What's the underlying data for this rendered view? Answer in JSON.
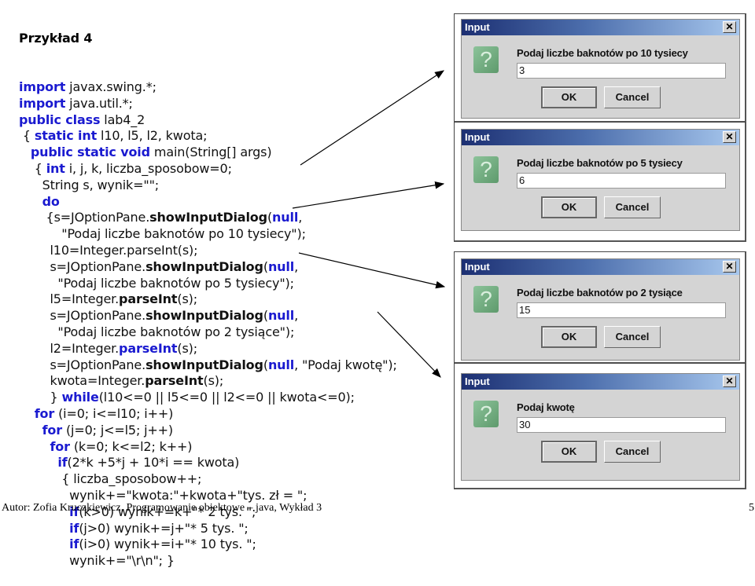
{
  "slide": {
    "title": "Przykład 4",
    "footer": "Autor: Zofia Kruczkiewicz, Programowanie obiektowe – java, Wykład 3",
    "page_number": "5"
  },
  "code_lines": [
    [
      {
        "t": "import",
        "c": "kw"
      },
      {
        "t": " javax.swing.*;"
      }
    ],
    [
      {
        "t": "import",
        "c": "kw"
      },
      {
        "t": " java.util.*;"
      }
    ],
    [
      {
        "t": "public class",
        "c": "kw"
      },
      {
        "t": " lab4_2"
      }
    ],
    [
      {
        "t": " { "
      },
      {
        "t": "static int",
        "c": "kw"
      },
      {
        "t": " l10, l5, l2, kwota;"
      }
    ],
    [
      {
        "t": "   "
      },
      {
        "t": "public static void",
        "c": "kw"
      },
      {
        "t": " main(String[] args)"
      }
    ],
    [
      {
        "t": "    { "
      },
      {
        "t": "int",
        "c": "kw"
      },
      {
        "t": " i, j, k, liczba_sposobow=0;"
      }
    ],
    [
      {
        "t": "      String s, wynik=\"\";"
      }
    ],
    [
      {
        "t": "      "
      },
      {
        "t": "do",
        "c": "kw"
      }
    ],
    [
      {
        "t": "       {s=JOptionPane."
      },
      {
        "t": "showInputDialog",
        "c": "bd"
      },
      {
        "t": "("
      },
      {
        "t": "null",
        "c": "kw"
      },
      {
        "t": ","
      }
    ],
    [
      {
        "t": "           \"Podaj liczbe baknotów po 10 tysiecy\");"
      }
    ],
    [
      {
        "t": "        l10=Integer.parseInt(s);"
      }
    ],
    [
      {
        "t": "        s=JOptionPane."
      },
      {
        "t": "showInputDialog",
        "c": "bd"
      },
      {
        "t": "("
      },
      {
        "t": "null",
        "c": "kw"
      },
      {
        "t": ","
      }
    ],
    [
      {
        "t": "          \"Podaj liczbe baknotów po 5 tysiecy\");"
      }
    ],
    [
      {
        "t": "        l5=Integer."
      },
      {
        "t": "parseInt",
        "c": "bd"
      },
      {
        "t": "(s);"
      }
    ],
    [
      {
        "t": "        s=JOptionPane."
      },
      {
        "t": "showInputDialog",
        "c": "bd"
      },
      {
        "t": "("
      },
      {
        "t": "null",
        "c": "kw"
      },
      {
        "t": ","
      }
    ],
    [
      {
        "t": "          \"Podaj liczbe baknotów po 2 tysiące\");"
      }
    ],
    [
      {
        "t": "        l2=Integer."
      },
      {
        "t": "parseInt",
        "c": "kw"
      },
      {
        "t": "(s);"
      }
    ],
    [
      {
        "t": "        s=JOptionPane."
      },
      {
        "t": "showInputDialog",
        "c": "bd"
      },
      {
        "t": "("
      },
      {
        "t": "null",
        "c": "kw"
      },
      {
        "t": ", \"Podaj kwotę\");"
      }
    ],
    [
      {
        "t": "        kwota=Integer."
      },
      {
        "t": "parseInt",
        "c": "bd"
      },
      {
        "t": "(s);"
      }
    ],
    [
      {
        "t": "        } "
      },
      {
        "t": "while",
        "c": "kw"
      },
      {
        "t": "(l10<=0 || l5<=0 || l2<=0 || kwota<=0);"
      }
    ],
    [
      {
        "t": "    "
      },
      {
        "t": "for",
        "c": "kw"
      },
      {
        "t": " (i=0; i<=l10; i++)"
      }
    ],
    [
      {
        "t": "      "
      },
      {
        "t": "for",
        "c": "kw"
      },
      {
        "t": " (j=0; j<=l5; j++)"
      }
    ],
    [
      {
        "t": "        "
      },
      {
        "t": "for",
        "c": "kw"
      },
      {
        "t": " (k=0; k<=l2; k++)"
      }
    ],
    [
      {
        "t": "          "
      },
      {
        "t": "if",
        "c": "kw"
      },
      {
        "t": "(2*k +5*j + 10*i == kwota)"
      }
    ],
    [
      {
        "t": "           { liczba_sposobow++;"
      }
    ],
    [
      {
        "t": "             wynik+=\"kwota:\"+kwota+\"tys. zł = \";"
      }
    ],
    [
      {
        "t": "             "
      },
      {
        "t": "if",
        "c": "kw"
      },
      {
        "t": "(k>0) wynik+=k+\"* 2 tys. \";"
      }
    ],
    [
      {
        "t": "             "
      },
      {
        "t": "if",
        "c": "kw"
      },
      {
        "t": "(j>0) wynik+=j+\"* 5 tys. \";"
      }
    ],
    [
      {
        "t": "             "
      },
      {
        "t": "if",
        "c": "kw"
      },
      {
        "t": "(i>0) wynik+=i+\"* 10 tys. \";"
      }
    ],
    [
      {
        "t": "             wynik+=\"\\r\\n\"; }"
      }
    ]
  ],
  "dialogs": [
    {
      "title": "Input",
      "message": "Podaj liczbe baknotów po 10 tysiecy",
      "value": "3",
      "ok": "OK",
      "cancel": "Cancel",
      "icon": "question-icon",
      "close": "✕"
    },
    {
      "title": "Input",
      "message": "Podaj liczbe baknotów po 5 tysiecy",
      "value": "6",
      "ok": "OK",
      "cancel": "Cancel",
      "icon": "question-icon",
      "close": "✕"
    },
    {
      "title": "Input",
      "message": "Podaj liczbe baknotów po 2 tysiące",
      "value": "15",
      "ok": "OK",
      "cancel": "Cancel",
      "icon": "question-icon",
      "close": "✕"
    },
    {
      "title": "Input",
      "message": "Podaj kwotę",
      "value": "30",
      "ok": "OK",
      "cancel": "Cancel",
      "icon": "question-icon",
      "close": "✕"
    }
  ],
  "colors": {
    "keyword": "#1a1ad0",
    "titlebar_start": "#1c2f72",
    "titlebar_end": "#a8c8ee",
    "dialog_bg": "#d4d4d4",
    "icon_green": "#6fae7e"
  }
}
